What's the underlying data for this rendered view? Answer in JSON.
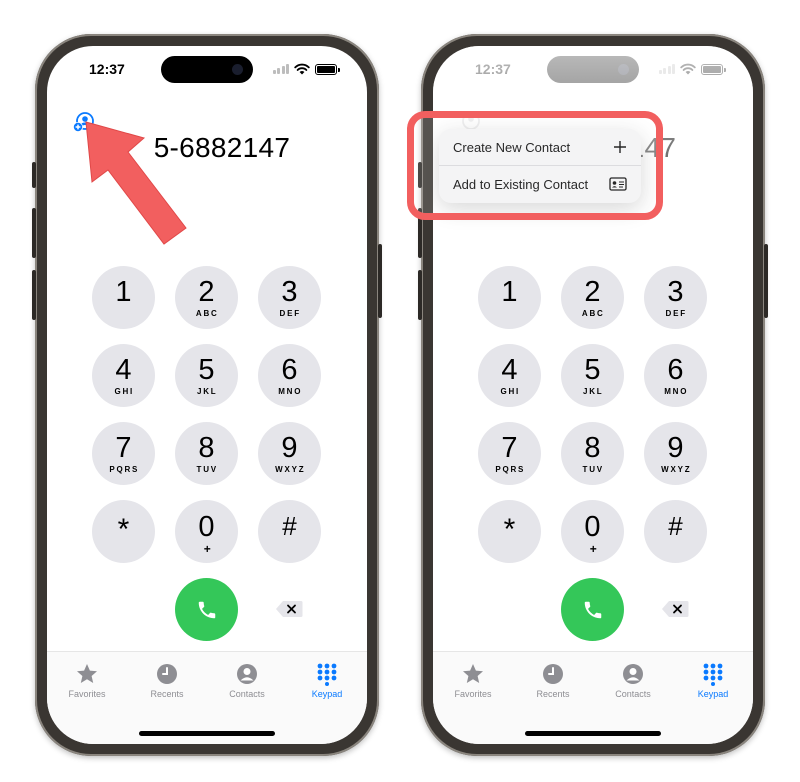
{
  "status": {
    "time": "12:37"
  },
  "dialer": {
    "number": "5-6882147"
  },
  "keys": [
    {
      "digit": "1",
      "letters": ""
    },
    {
      "digit": "2",
      "letters": "ABC"
    },
    {
      "digit": "3",
      "letters": "DEF"
    },
    {
      "digit": "4",
      "letters": "GHI"
    },
    {
      "digit": "5",
      "letters": "JKL"
    },
    {
      "digit": "6",
      "letters": "MNO"
    },
    {
      "digit": "7",
      "letters": "PQRS"
    },
    {
      "digit": "8",
      "letters": "TUV"
    },
    {
      "digit": "9",
      "letters": "WXYZ"
    },
    {
      "digit": "*",
      "letters": ""
    },
    {
      "digit": "0",
      "letters": "+"
    },
    {
      "digit": "#",
      "letters": ""
    }
  ],
  "tabs": [
    {
      "label": "Favorites",
      "icon": "star-icon",
      "active": false
    },
    {
      "label": "Recents",
      "icon": "clock-icon",
      "active": false
    },
    {
      "label": "Contacts",
      "icon": "person-circle-icon",
      "active": false
    },
    {
      "label": "Keypad",
      "icon": "keypad-grid-icon",
      "active": true
    }
  ],
  "menu": {
    "create_new": "Create New Contact",
    "add_existing": "Add to Existing Contact"
  },
  "colors": {
    "accent": "#0a7aff",
    "call_green": "#34c759",
    "key_gray": "#e5e5ea",
    "annotation_red": "#f25f5f"
  }
}
